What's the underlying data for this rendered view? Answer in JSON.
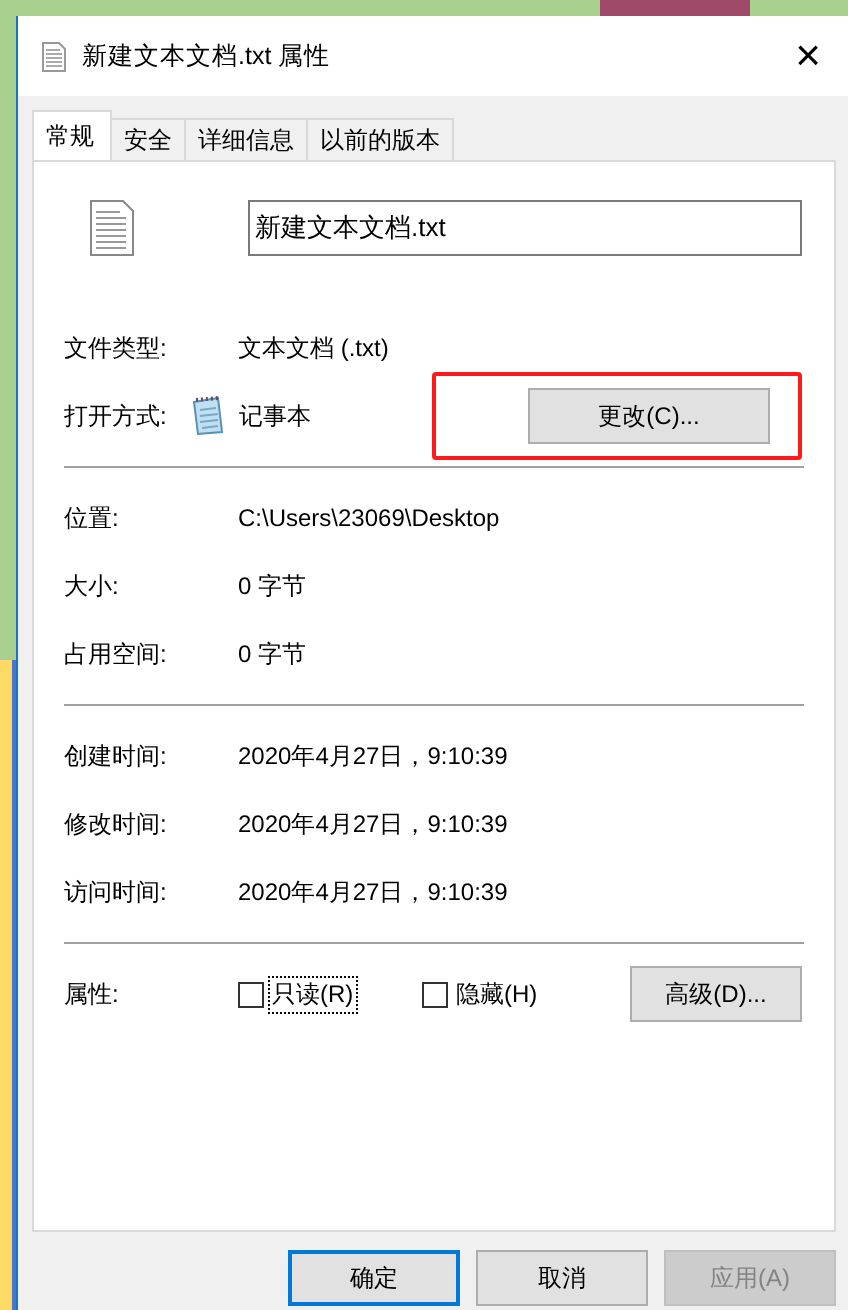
{
  "window": {
    "title": "新建文本文档.txt 属性",
    "close": "×"
  },
  "tabs": [
    {
      "label": "常规",
      "selected": true
    },
    {
      "label": "安全",
      "selected": false
    },
    {
      "label": "详细信息",
      "selected": false
    },
    {
      "label": "以前的版本",
      "selected": false
    }
  ],
  "file_name": {
    "value": "新建文本文档.txt"
  },
  "type_section": [
    {
      "label": "文件类型:",
      "value": "文本文档 (.txt)",
      "kind": "text"
    },
    {
      "label": "打开方式:",
      "value": "记事本",
      "kind": "app",
      "button": "更改(C)...",
      "highlighted": true
    }
  ],
  "location_section": [
    {
      "label": "位置:",
      "value": "C:\\Users\\23069\\Desktop",
      "kind": "text"
    },
    {
      "label": "大小:",
      "value": "0 字节",
      "kind": "text"
    },
    {
      "label": "占用空间:",
      "value": "0 字节",
      "kind": "text"
    }
  ],
  "time_section": [
    {
      "label": "创建时间:",
      "value": "2020年4月27日，9:10:39",
      "kind": "text"
    },
    {
      "label": "修改时间:",
      "value": "2020年4月27日，9:10:39",
      "kind": "text"
    },
    {
      "label": "访问时间:",
      "value": "2020年4月27日，9:10:39",
      "kind": "text"
    }
  ],
  "attributes": {
    "label": "属性:",
    "checkboxes": [
      {
        "label": "只读(R)",
        "checked": false,
        "focused": true
      },
      {
        "label": "隐藏(H)",
        "checked": false,
        "focused": false
      }
    ],
    "button": "高级(D)..."
  },
  "buttons": [
    {
      "label": "确定",
      "default": true,
      "disabled": false
    },
    {
      "label": "取消",
      "default": false,
      "disabled": false
    },
    {
      "label": "应用(A)",
      "default": false,
      "disabled": true
    }
  ]
}
